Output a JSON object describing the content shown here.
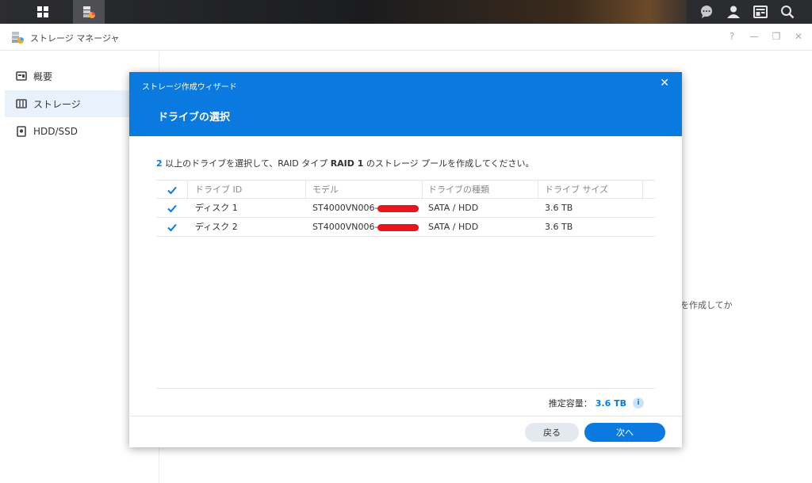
{
  "app": {
    "title": "ストレージ マネージャ"
  },
  "window_controls": {
    "help": "?",
    "minimize": "—",
    "restore": "❐",
    "close": "✕"
  },
  "sidebar": {
    "items": [
      {
        "label": "概要",
        "icon": "overview-icon",
        "active": false
      },
      {
        "label": "ストレージ",
        "icon": "storage-icon",
        "active": true
      },
      {
        "label": "HDD/SSD",
        "icon": "hdd-icon",
        "active": false
      }
    ]
  },
  "background": {
    "partial_text": "を作成してか"
  },
  "wizard": {
    "subtitle": "ストレージ作成ウィザード",
    "title": "ドライブの選択",
    "close": "✕",
    "instruction": {
      "count": "2",
      "part1": " 以上のドライブを選択して、RAID タイプ ",
      "raid": "RAID 1",
      "part2": " のストレージ プールを作成してください。"
    },
    "table": {
      "headers": [
        "ドライブ ID",
        "モデル",
        "ドライブの種類",
        "ドライブ サイズ"
      ],
      "rows": [
        {
          "id": "ディスク 1",
          "model": "ST4000VN006-",
          "type": "SATA / HDD",
          "size": "3.6 TB",
          "checked": true
        },
        {
          "id": "ディスク 2",
          "model": "ST4000VN006-",
          "type": "SATA / HDD",
          "size": "3.6 TB",
          "checked": true
        }
      ]
    },
    "capacity": {
      "label": "推定容量：",
      "value": "3.6 TB",
      "info": "i"
    },
    "buttons": {
      "back": "戻る",
      "next": "次へ"
    }
  },
  "colors": {
    "accent": "#0a7ae0",
    "redaction": "#e8141e",
    "sidebar_active": "#e9f2fc"
  }
}
